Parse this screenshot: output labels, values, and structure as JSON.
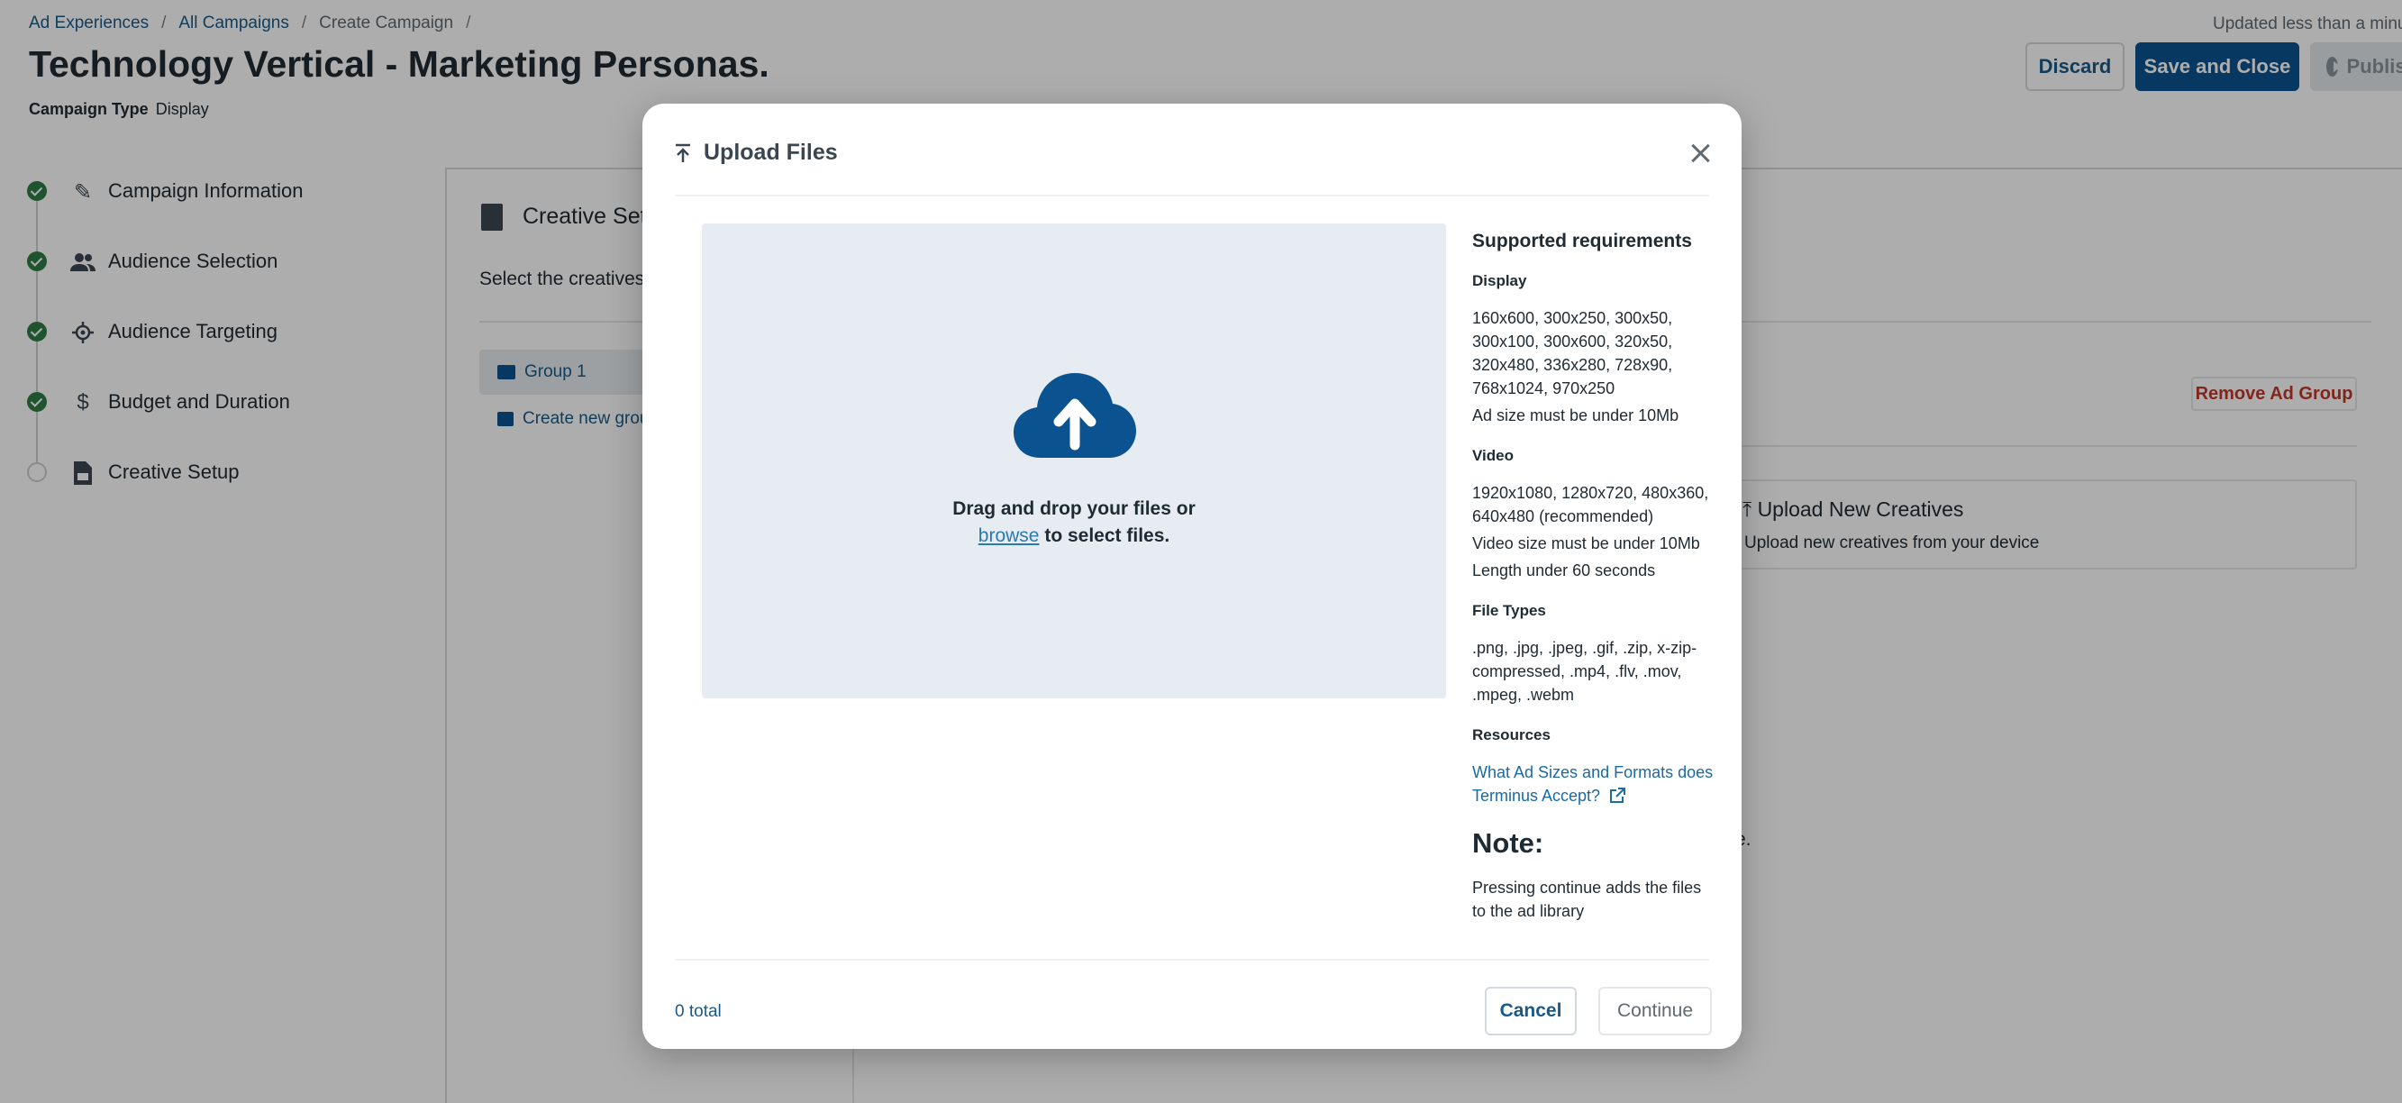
{
  "breadcrumb": {
    "items": [
      "Ad Experiences",
      "All Campaigns",
      "Create Campaign"
    ],
    "separator": "/"
  },
  "header": {
    "title": "Technology Vertical - Marketing Personas.",
    "campaign_type_label": "Campaign Type",
    "campaign_type_value": "Display",
    "updated_text": "Updated less than a minute ago",
    "discard_label": "Discard",
    "save_label": "Save and Close",
    "publish_label": "Publish"
  },
  "steps": [
    {
      "label": "Campaign Information",
      "icon": "pencil-icon",
      "status": "complete"
    },
    {
      "label": "Audience Selection",
      "icon": "people-icon",
      "status": "complete"
    },
    {
      "label": "Audience Targeting",
      "icon": "crosshair-icon",
      "status": "complete"
    },
    {
      "label": "Budget and Duration",
      "icon": "dollar-icon",
      "status": "complete"
    },
    {
      "label": "Creative Setup",
      "icon": "document-image-icon",
      "status": "incomplete"
    }
  ],
  "creative_panel": {
    "title": "Creative Setup",
    "subtitle": "Select the creatives",
    "group_label": "Group 1",
    "create_group_label": "Create new group",
    "remove_group_label": "Remove Ad Group",
    "upload_card_title": "Upload New Creatives",
    "upload_card_desc": "Upload new creatives from your device",
    "fragment_text": "e."
  },
  "modal": {
    "title": "Upload Files",
    "dropzone_line1": "Drag and drop your files or",
    "browse_label": "browse",
    "dropzone_line2": "to select files.",
    "requirements": {
      "heading": "Supported requirements",
      "display_heading": "Display",
      "display_sizes": "160x600, 300x250, 300x50, 300x100, 300x600, 320x50, 320x480, 336x280, 728x90, 768x1024, 970x250",
      "display_limit": "Ad size must be under 10Mb",
      "video_heading": "Video",
      "video_sizes": "1920x1080, 1280x720, 480x360, 640x480 (recommended)",
      "video_limit": "Video size must be under 10Mb",
      "video_length": "Length under 60 seconds",
      "file_types_heading": "File Types",
      "file_types": ".png, .jpg, .jpeg, .gif, .zip, x-zip-compressed, .mp4, .flv, .mov, .mpeg, .webm",
      "resources_heading": "Resources",
      "resource_link": "What Ad Sizes and Formats does Terminus Accept?",
      "note_heading": "Note:",
      "note_text": "Pressing continue adds the files to the ad library"
    },
    "total_text": "0 total",
    "cancel_label": "Cancel",
    "continue_label": "Continue"
  },
  "colors": {
    "primary": "#0b5390",
    "link": "#1a5a8a",
    "success": "#2e7d45",
    "danger": "#c0392b",
    "dropzone": "#e6ecf2"
  }
}
